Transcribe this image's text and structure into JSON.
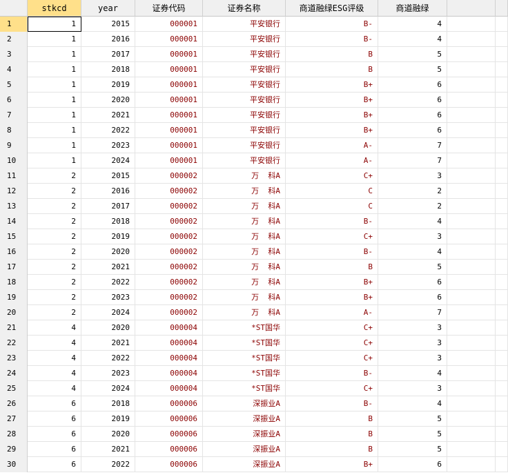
{
  "columns": [
    "",
    "stkcd",
    "year",
    "证券代码",
    "证券名称",
    "商道融绿ESG评级",
    "商道融绿",
    ""
  ],
  "rows": [
    {
      "n": "1",
      "stkcd": "1",
      "year": "2015",
      "code": "000001",
      "name": "平安银行",
      "rating": "B-",
      "score": "4"
    },
    {
      "n": "2",
      "stkcd": "1",
      "year": "2016",
      "code": "000001",
      "name": "平安银行",
      "rating": "B-",
      "score": "4"
    },
    {
      "n": "3",
      "stkcd": "1",
      "year": "2017",
      "code": "000001",
      "name": "平安银行",
      "rating": "B",
      "score": "5"
    },
    {
      "n": "4",
      "stkcd": "1",
      "year": "2018",
      "code": "000001",
      "name": "平安银行",
      "rating": "B",
      "score": "5"
    },
    {
      "n": "5",
      "stkcd": "1",
      "year": "2019",
      "code": "000001",
      "name": "平安银行",
      "rating": "B+",
      "score": "6"
    },
    {
      "n": "6",
      "stkcd": "1",
      "year": "2020",
      "code": "000001",
      "name": "平安银行",
      "rating": "B+",
      "score": "6"
    },
    {
      "n": "7",
      "stkcd": "1",
      "year": "2021",
      "code": "000001",
      "name": "平安银行",
      "rating": "B+",
      "score": "6"
    },
    {
      "n": "8",
      "stkcd": "1",
      "year": "2022",
      "code": "000001",
      "name": "平安银行",
      "rating": "B+",
      "score": "6"
    },
    {
      "n": "9",
      "stkcd": "1",
      "year": "2023",
      "code": "000001",
      "name": "平安银行",
      "rating": "A-",
      "score": "7"
    },
    {
      "n": "10",
      "stkcd": "1",
      "year": "2024",
      "code": "000001",
      "name": "平安银行",
      "rating": "A-",
      "score": "7"
    },
    {
      "n": "11",
      "stkcd": "2",
      "year": "2015",
      "code": "000002",
      "name": "万  科A",
      "rating": "C+",
      "score": "3"
    },
    {
      "n": "12",
      "stkcd": "2",
      "year": "2016",
      "code": "000002",
      "name": "万  科A",
      "rating": "C",
      "score": "2"
    },
    {
      "n": "13",
      "stkcd": "2",
      "year": "2017",
      "code": "000002",
      "name": "万  科A",
      "rating": "C",
      "score": "2"
    },
    {
      "n": "14",
      "stkcd": "2",
      "year": "2018",
      "code": "000002",
      "name": "万  科A",
      "rating": "B-",
      "score": "4"
    },
    {
      "n": "15",
      "stkcd": "2",
      "year": "2019",
      "code": "000002",
      "name": "万  科A",
      "rating": "C+",
      "score": "3"
    },
    {
      "n": "16",
      "stkcd": "2",
      "year": "2020",
      "code": "000002",
      "name": "万  科A",
      "rating": "B-",
      "score": "4"
    },
    {
      "n": "17",
      "stkcd": "2",
      "year": "2021",
      "code": "000002",
      "name": "万  科A",
      "rating": "B",
      "score": "5"
    },
    {
      "n": "18",
      "stkcd": "2",
      "year": "2022",
      "code": "000002",
      "name": "万  科A",
      "rating": "B+",
      "score": "6"
    },
    {
      "n": "19",
      "stkcd": "2",
      "year": "2023",
      "code": "000002",
      "name": "万  科A",
      "rating": "B+",
      "score": "6"
    },
    {
      "n": "20",
      "stkcd": "2",
      "year": "2024",
      "code": "000002",
      "name": "万  科A",
      "rating": "A-",
      "score": "7"
    },
    {
      "n": "21",
      "stkcd": "4",
      "year": "2020",
      "code": "000004",
      "name": "*ST国华",
      "rating": "C+",
      "score": "3"
    },
    {
      "n": "22",
      "stkcd": "4",
      "year": "2021",
      "code": "000004",
      "name": "*ST国华",
      "rating": "C+",
      "score": "3"
    },
    {
      "n": "23",
      "stkcd": "4",
      "year": "2022",
      "code": "000004",
      "name": "*ST国华",
      "rating": "C+",
      "score": "3"
    },
    {
      "n": "24",
      "stkcd": "4",
      "year": "2023",
      "code": "000004",
      "name": "*ST国华",
      "rating": "B-",
      "score": "4"
    },
    {
      "n": "25",
      "stkcd": "4",
      "year": "2024",
      "code": "000004",
      "name": "*ST国华",
      "rating": "C+",
      "score": "3"
    },
    {
      "n": "26",
      "stkcd": "6",
      "year": "2018",
      "code": "000006",
      "name": "深振业A",
      "rating": "B-",
      "score": "4"
    },
    {
      "n": "27",
      "stkcd": "6",
      "year": "2019",
      "code": "000006",
      "name": "深振业A",
      "rating": "B",
      "score": "5"
    },
    {
      "n": "28",
      "stkcd": "6",
      "year": "2020",
      "code": "000006",
      "name": "深振业A",
      "rating": "B",
      "score": "5"
    },
    {
      "n": "29",
      "stkcd": "6",
      "year": "2021",
      "code": "000006",
      "name": "深振业A",
      "rating": "B",
      "score": "5"
    },
    {
      "n": "30",
      "stkcd": "6",
      "year": "2022",
      "code": "000006",
      "name": "深振业A",
      "rating": "B+",
      "score": "6"
    }
  ]
}
